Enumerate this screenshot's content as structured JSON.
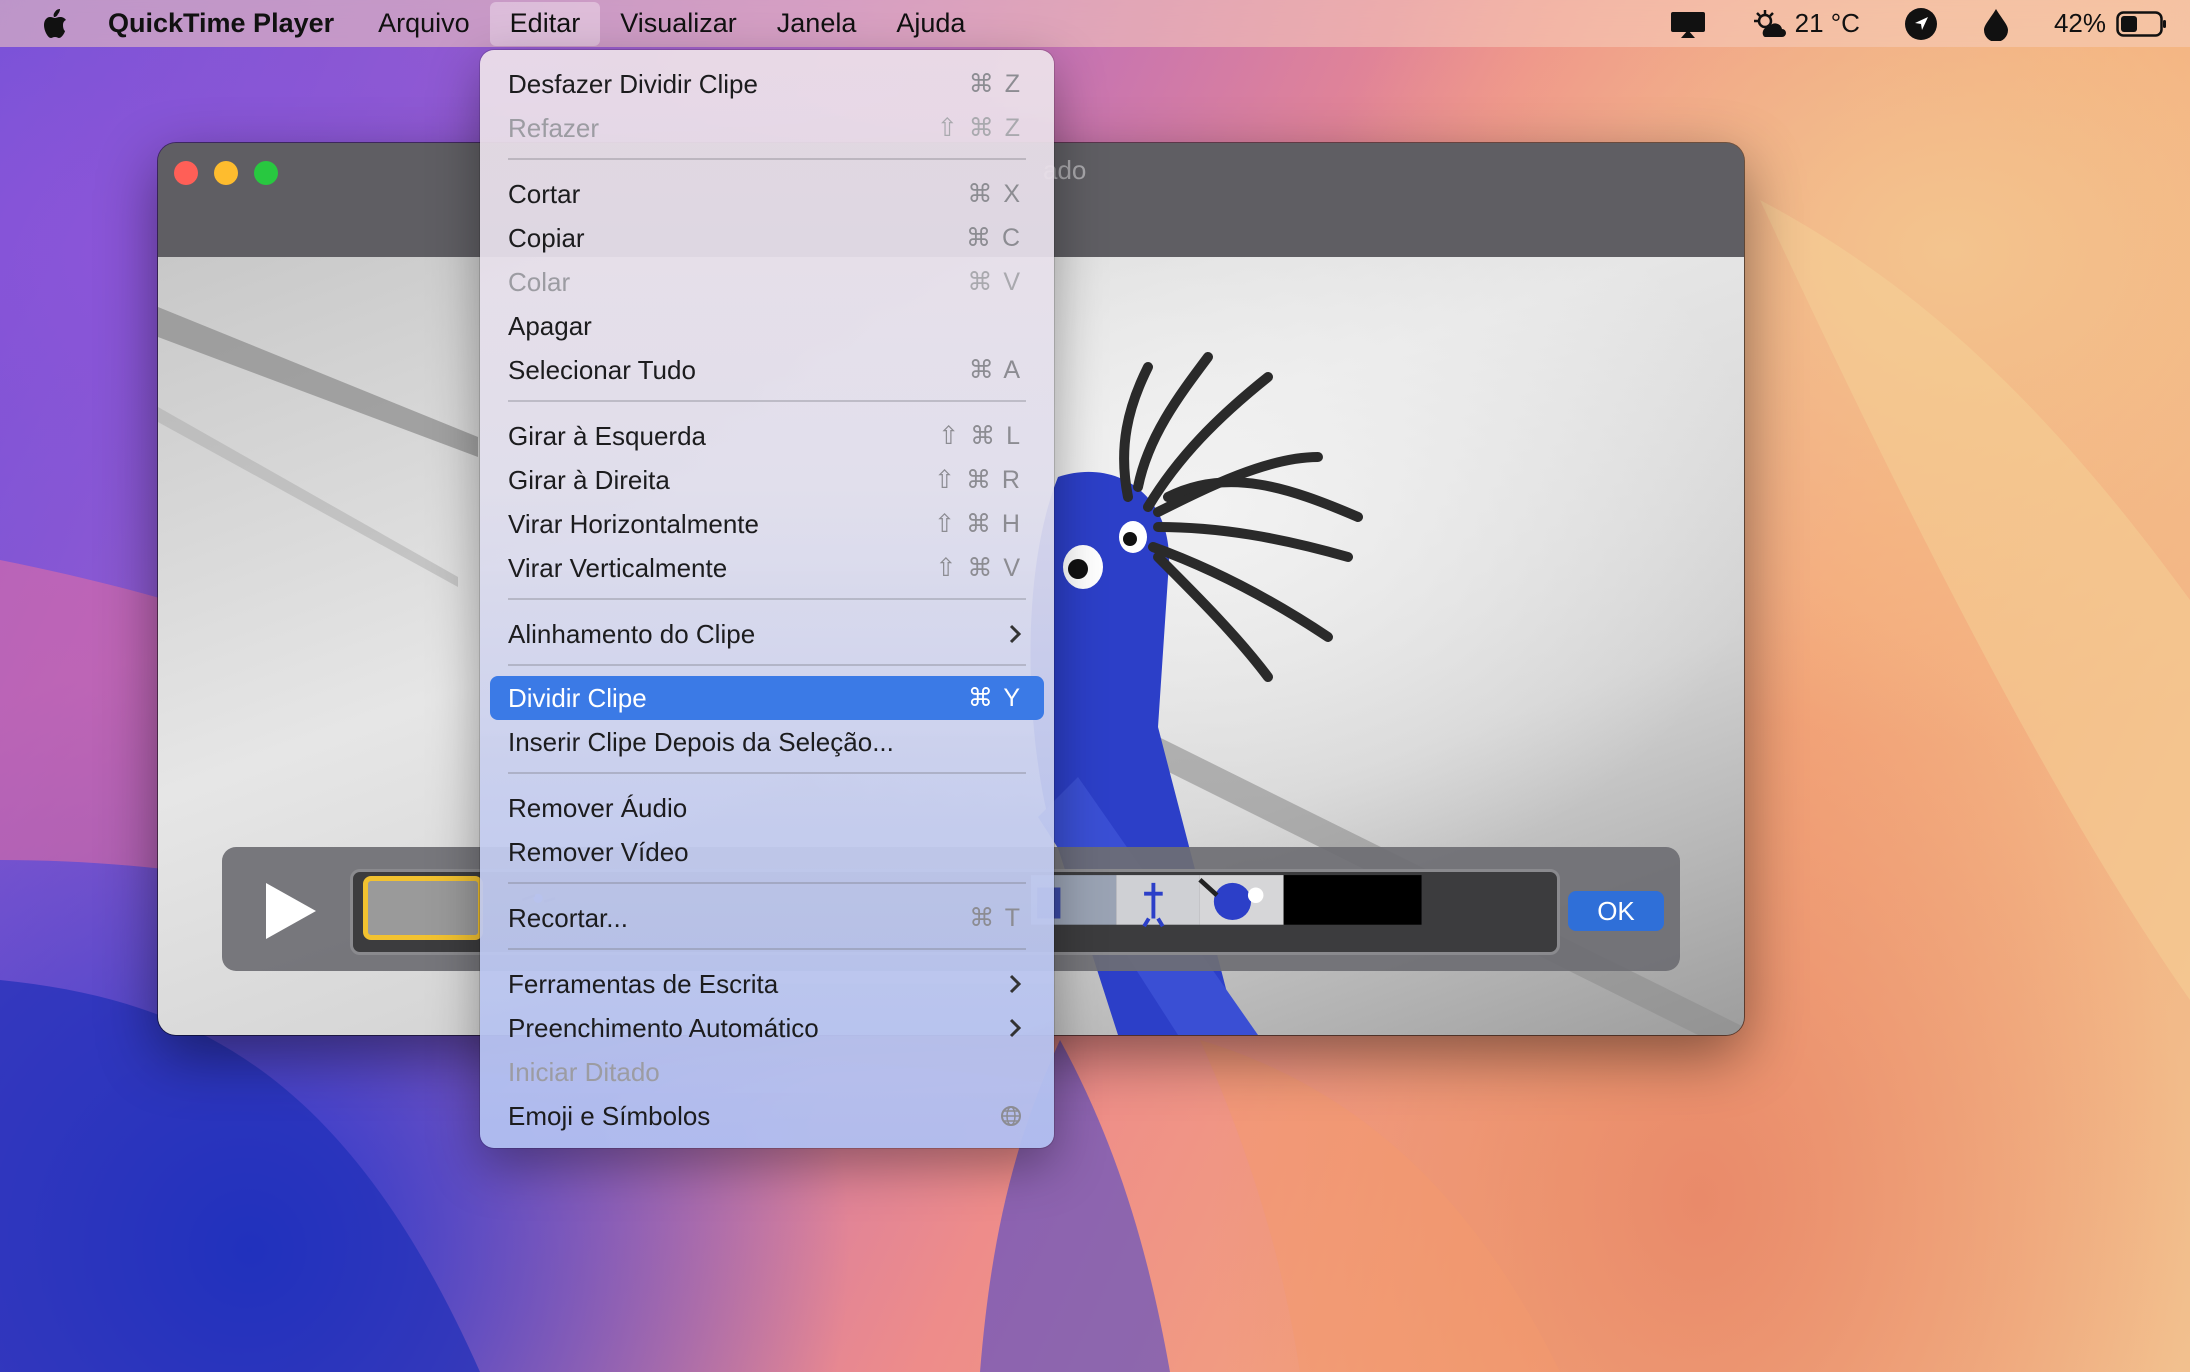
{
  "menubar": {
    "app_name": "QuickTime Player",
    "menus": [
      "Arquivo",
      "Editar",
      "Visualizar",
      "Janela",
      "Ajuda"
    ],
    "active_menu": "Editar",
    "weather": "21 °C",
    "battery": "42%"
  },
  "window": {
    "title_fragment": "ado",
    "ok_label": "OK"
  },
  "edit_menu": {
    "items": [
      {
        "label": "Desfazer Dividir Clipe",
        "shortcut": "⌘ Z"
      },
      {
        "label": "Refazer",
        "shortcut": "⇧ ⌘ Z",
        "disabled": true
      },
      {
        "label": "Cortar",
        "shortcut": "⌘ X"
      },
      {
        "label": "Copiar",
        "shortcut": "⌘ C"
      },
      {
        "label": "Colar",
        "shortcut": "⌘ V",
        "disabled": true
      },
      {
        "label": "Apagar",
        "shortcut": ""
      },
      {
        "label": "Selecionar Tudo",
        "shortcut": "⌘ A"
      },
      {
        "label": "Girar à Esquerda",
        "shortcut": "⇧ ⌘ L"
      },
      {
        "label": "Girar à Direita",
        "shortcut": "⇧ ⌘ R"
      },
      {
        "label": "Virar Horizontalmente",
        "shortcut": "⇧ ⌘ H"
      },
      {
        "label": "Virar Verticalmente",
        "shortcut": "⇧ ⌘ V"
      },
      {
        "label": "Alinhamento do Clipe",
        "submenu": true
      },
      {
        "label": "Dividir Clipe",
        "shortcut": "⌘ Y",
        "highlighted": true
      },
      {
        "label": "Inserir Clipe Depois da Seleção...",
        "shortcut": ""
      },
      {
        "label": "Remover Áudio",
        "shortcut": ""
      },
      {
        "label": "Remover Vídeo",
        "shortcut": ""
      },
      {
        "label": "Recortar...",
        "shortcut": "⌘ T"
      },
      {
        "label": "Ferramentas de Escrita",
        "submenu": true
      },
      {
        "label": "Preenchimento Automático",
        "submenu": true
      },
      {
        "label": "Iniciar Ditado",
        "disabled": true
      },
      {
        "label": "Emoji e Símbolos",
        "icon": "globe-icon"
      }
    ]
  },
  "colors": {
    "highlight": "#3b7ae6",
    "ok_button": "#2f6fd8",
    "selection_border": "#f2c230"
  }
}
